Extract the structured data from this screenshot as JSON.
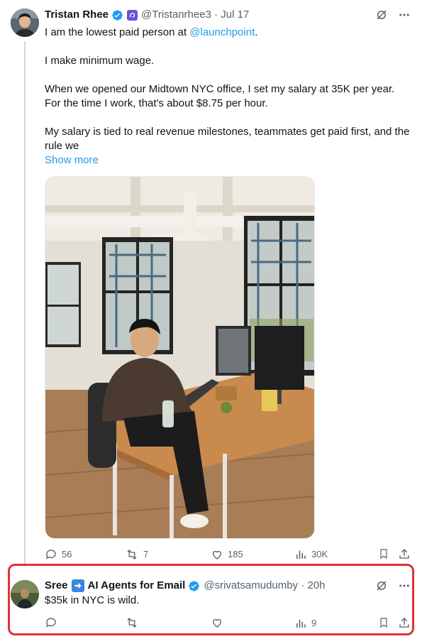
{
  "tweet": {
    "author": {
      "display_name": "Tristan Rhee",
      "verified": true,
      "affiliation_icon": "purple-brand-badge-icon",
      "handle": "@Tristanrhee3",
      "separator": "·",
      "date": "Jul 17"
    },
    "text": {
      "line1_prefix": "I am the lowest paid person at ",
      "line1_mention": "@launchpoint",
      "line1_suffix": ".",
      "para2": "I make minimum wage.",
      "para3": "When we opened our Midtown NYC office, I set my salary at 35K per year. For the time I work, that's about $8.75 per hour.",
      "para4": "My salary is tied to real revenue milestones, teammates get paid first, and the rule we"
    },
    "show_more": "Show more",
    "image": "photo of a man in a hoodie working at a wooden desk with two monitors in an office with large windows",
    "stats": {
      "replies": "56",
      "reposts": "7",
      "likes": "185",
      "views": "30K"
    }
  },
  "reply": {
    "author": {
      "display_name_part1": "Sree",
      "emoji_icon": "right-arrow-emoji-icon",
      "display_name_part2": "AI Agents for Email",
      "verified": true,
      "handle": "@srivatsamudumby",
      "separator": "·",
      "time": "20h"
    },
    "text": "$35k in NYC is wild.",
    "stats": {
      "replies": "",
      "reposts": "",
      "likes": "",
      "views": "9"
    }
  },
  "colors": {
    "accent": "#1d9bf0",
    "secondary_text": "#536471",
    "highlight_box": "#e0313a",
    "thread_line": "#cfd9de"
  }
}
